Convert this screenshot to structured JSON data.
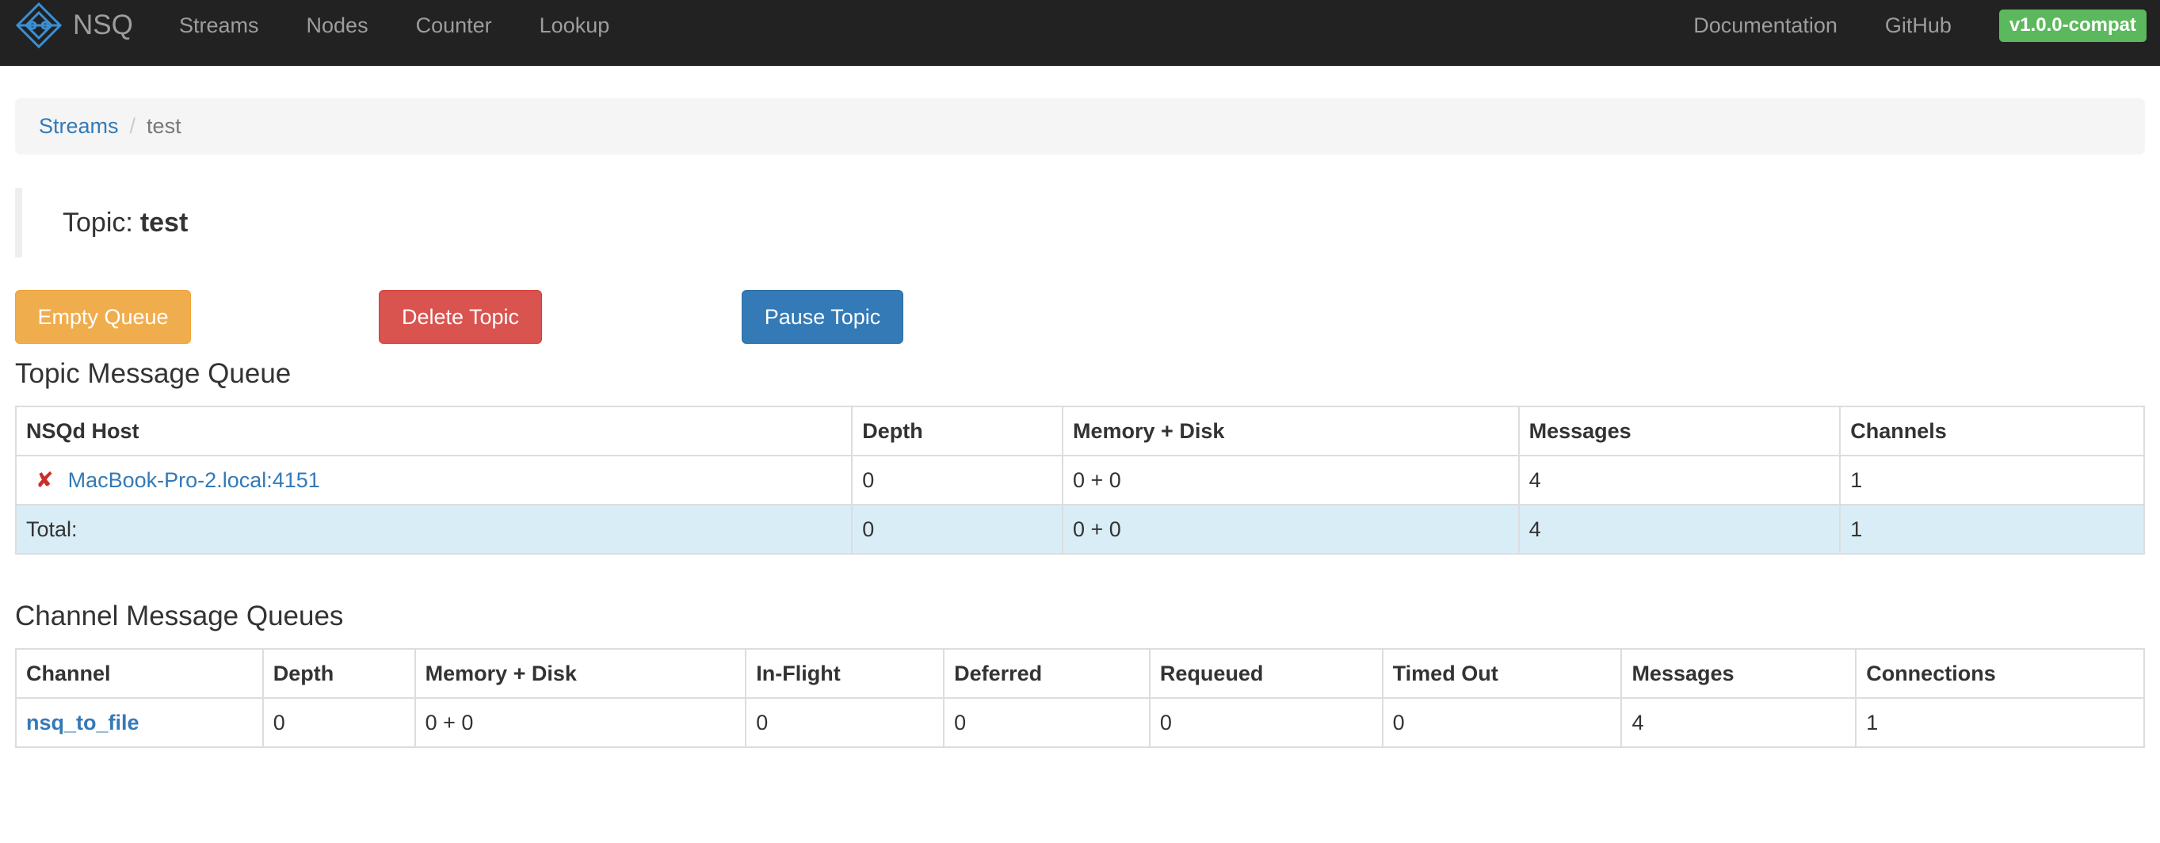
{
  "navbar": {
    "brand": "NSQ",
    "links": [
      "Streams",
      "Nodes",
      "Counter",
      "Lookup"
    ],
    "right_links": [
      "Documentation",
      "GitHub"
    ],
    "version": "v1.0.0-compat"
  },
  "breadcrumb": {
    "parent": "Streams",
    "separator": "/",
    "current": "test"
  },
  "topic": {
    "label": "Topic:",
    "name": "test"
  },
  "actions": {
    "empty_queue": "Empty Queue",
    "delete_topic": "Delete Topic",
    "pause_topic": "Pause Topic"
  },
  "topic_queue": {
    "title": "Topic Message Queue",
    "columns": [
      "NSQd Host",
      "Depth",
      "Memory + Disk",
      "Messages",
      "Channels"
    ],
    "rows": [
      {
        "host": "MacBook-Pro-2.local:4151",
        "status_icon": "error-x-icon",
        "depth": "0",
        "memory_disk": "0 + 0",
        "messages": "4",
        "channels": "1"
      }
    ],
    "total": {
      "label": "Total:",
      "depth": "0",
      "memory_disk": "0 + 0",
      "messages": "4",
      "channels": "1"
    }
  },
  "channel_queues": {
    "title": "Channel Message Queues",
    "columns": [
      "Channel",
      "Depth",
      "Memory + Disk",
      "In-Flight",
      "Deferred",
      "Requeued",
      "Timed Out",
      "Messages",
      "Connections"
    ],
    "rows": [
      {
        "channel": "nsq_to_file",
        "depth": "0",
        "memory_disk": "0 + 0",
        "in_flight": "0",
        "deferred": "0",
        "requeued": "0",
        "timed_out": "0",
        "messages": "4",
        "connections": "1"
      }
    ]
  },
  "colors": {
    "navbar_bg": "#222222",
    "link": "#337ab7",
    "warning": "#f0ad4e",
    "danger": "#d9534f",
    "primary": "#337ab7",
    "success": "#5cb85c",
    "total_row": "#d9edf7"
  }
}
